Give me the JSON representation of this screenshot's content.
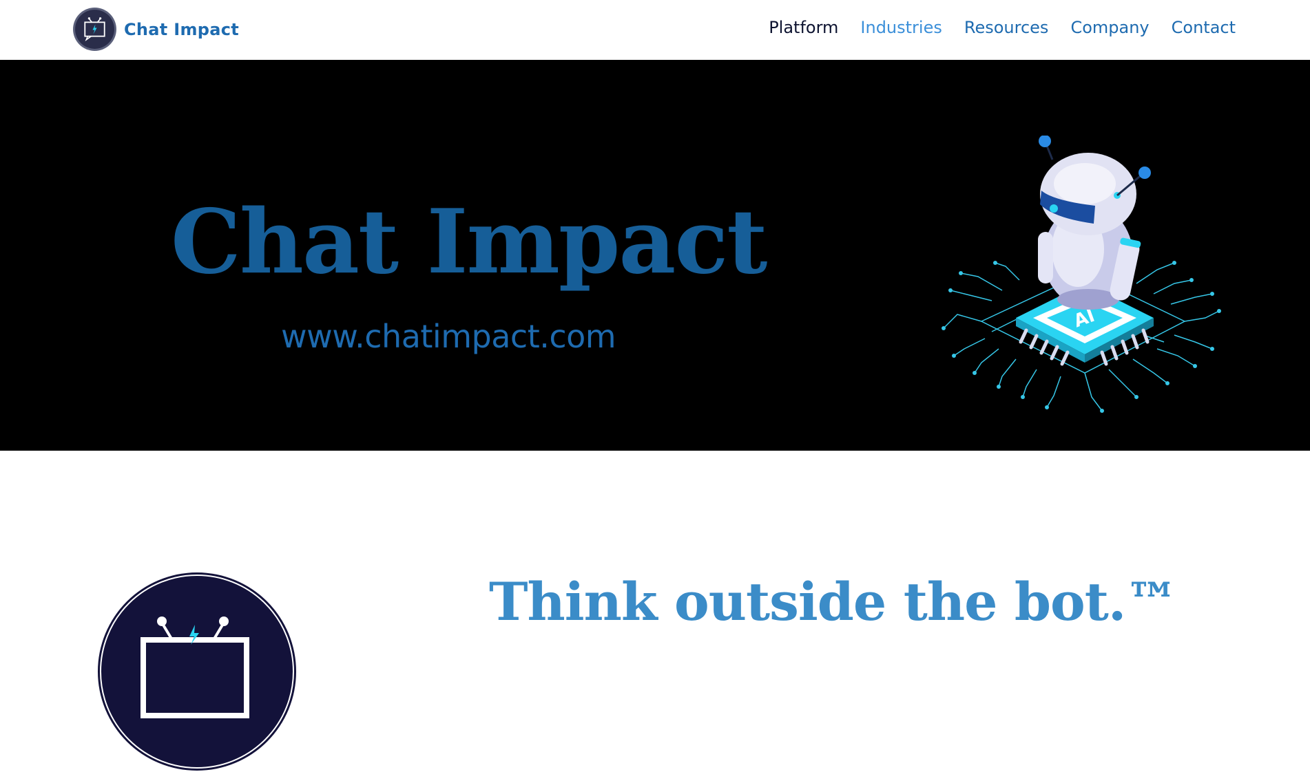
{
  "header": {
    "brand": "Chat Impact",
    "nav": [
      "Platform",
      "Industries",
      "Resources",
      "Company",
      "Contact"
    ]
  },
  "hero": {
    "title": "Chat Impact",
    "url": "www.chatimpact.com",
    "art_label": "AI"
  },
  "section": {
    "tagline": "Think outside the bot.™"
  },
  "colors": {
    "brand_blue": "#1e6bb0",
    "hero_title": "#165e98",
    "tagline": "#3b8cc8",
    "nav_active": "#3b8fd9",
    "navy": "#13123a",
    "cyan": "#2ad4f2"
  },
  "icons": [
    "tv-chat-logo-icon",
    "robot-circuit-illustration"
  ]
}
